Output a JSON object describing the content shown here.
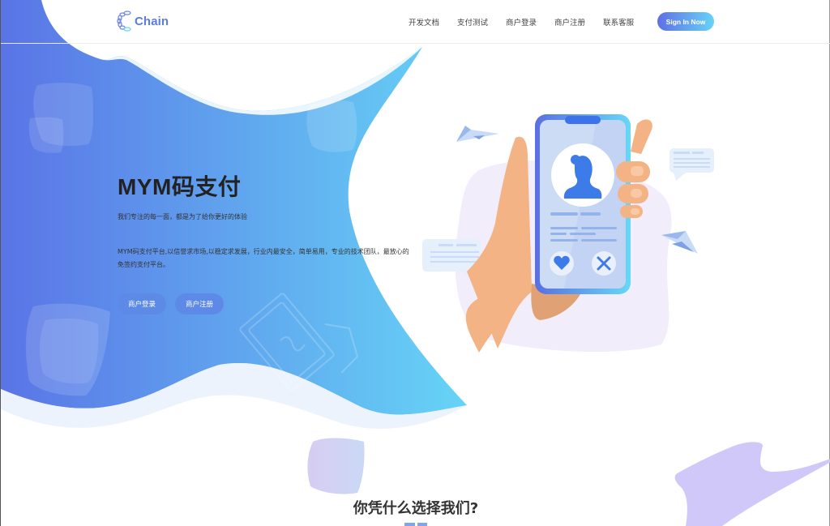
{
  "header": {
    "logo": {
      "icon": "chain-link-icon",
      "text": "Chain"
    },
    "nav": [
      {
        "label": "开发文档"
      },
      {
        "label": "支付测试"
      },
      {
        "label": "商户登录"
      },
      {
        "label": "商户注册"
      },
      {
        "label": "联系客服"
      }
    ],
    "signin_label": "Sign In Now"
  },
  "hero": {
    "title": "MYM码支付",
    "subtitle": "我们专注的每一面，都是为了给你更好的体验",
    "description": "MYM码支付平台,以信誉求市场,以稳定求发展，行业内最安全，简单易用，专业的技术团队，最放心的免签约支付平台。",
    "buttons": [
      {
        "label": "商户登录"
      },
      {
        "label": "商户注册"
      }
    ],
    "illustration": "hand-holding-phone-profile-illustration"
  },
  "features": {
    "title": "你凭什么选择我们?"
  },
  "colors": {
    "gradient_start": "#5a74e6",
    "gradient_end": "#66d2f5",
    "accent_purple": "#cfc8f8",
    "skin": "#f3b384"
  }
}
